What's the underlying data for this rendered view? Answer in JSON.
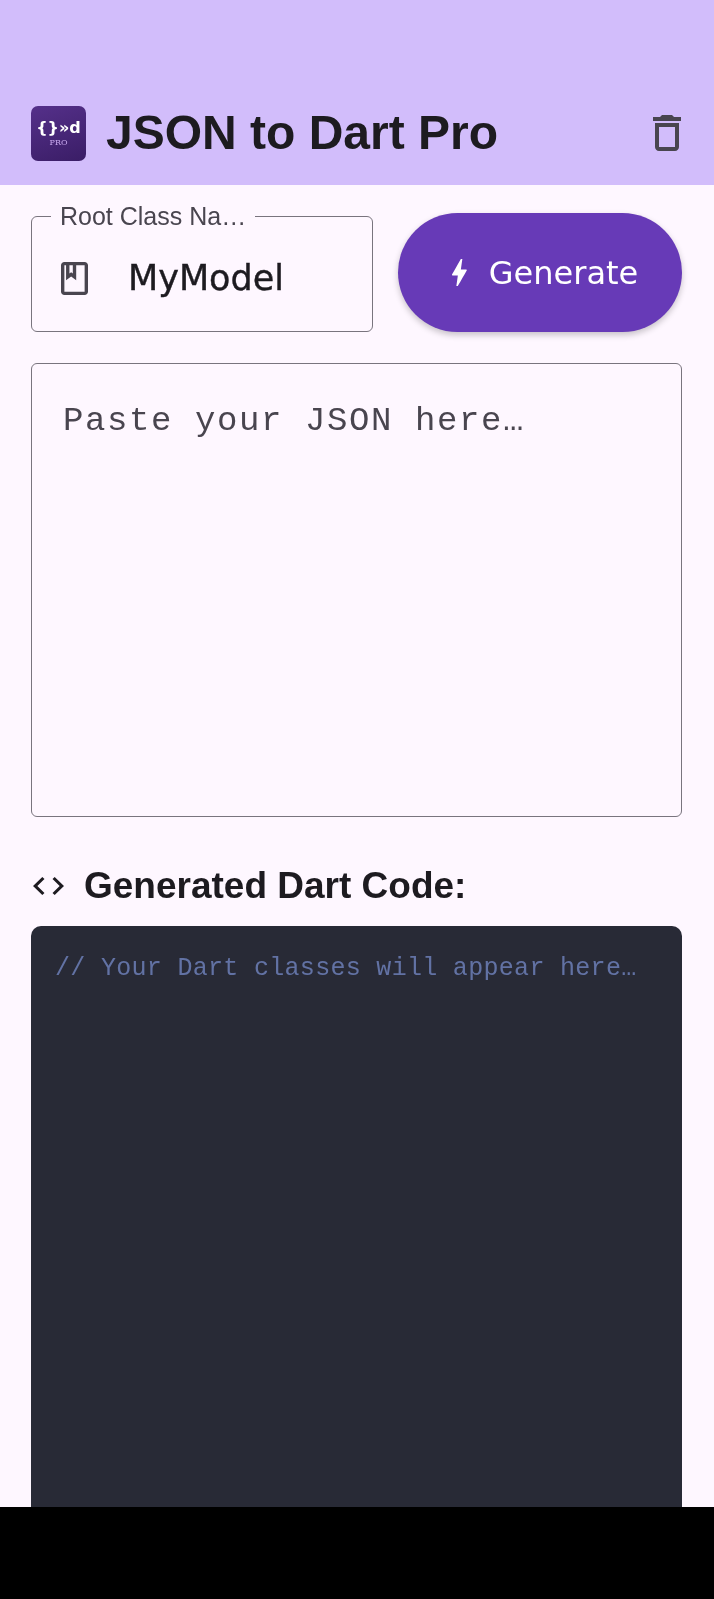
{
  "app_bar": {
    "logo": {
      "mark": "{}»d",
      "badge": "PRO"
    },
    "title": "JSON to Dart Pro"
  },
  "class_name_field": {
    "label": "Root Class Na…",
    "value": "MyModel"
  },
  "generate_button": {
    "label": "Generate"
  },
  "json_input": {
    "placeholder": "Paste your JSON here…"
  },
  "output": {
    "heading": "Generated Dart Code:",
    "text": "// Your Dart classes will appear here…"
  }
}
